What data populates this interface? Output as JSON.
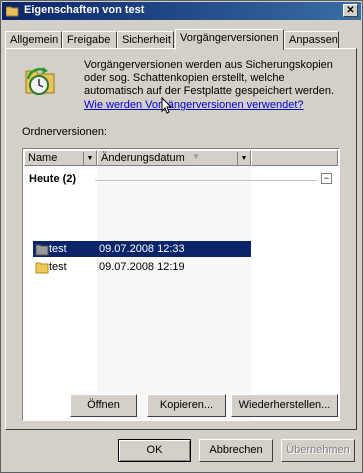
{
  "window": {
    "title": "Eigenschaften von test"
  },
  "tabs": [
    {
      "label": "Allgemein"
    },
    {
      "label": "Freigabe"
    },
    {
      "label": "Sicherheit"
    },
    {
      "label": "Vorgängerversionen"
    },
    {
      "label": "Anpassen"
    }
  ],
  "description": {
    "line1": "Vorgängerversionen werden aus Sicherungskopien",
    "line2": "oder sog. Schattenkopien erstellt, welche",
    "line3": "automatisch auf der Festplatte gespeichert werden.",
    "link": "Wie werden Vorgängerversionen verwendet?"
  },
  "list": {
    "label": "Ordnerversionen:",
    "columns": [
      {
        "label": "Name"
      },
      {
        "label": "Änderungsdatum"
      }
    ],
    "group": {
      "title": "Heute (2)",
      "toggle": "−"
    },
    "rows": [
      {
        "name": "test",
        "date": "09.07.2008 12:33"
      },
      {
        "name": "test",
        "date": "09.07.2008 12:19"
      }
    ]
  },
  "actions": {
    "open": "Öffnen",
    "copy": "Kopieren...",
    "restore": "Wiederherstellen..."
  },
  "dialog": {
    "ok": "OK",
    "cancel": "Abbrechen",
    "apply": "Übernehmen"
  },
  "colors": {
    "selection": "#0a246a",
    "title_start": "#0a246a",
    "title_end": "#3a6ea5",
    "face": "#d4d0c8"
  }
}
